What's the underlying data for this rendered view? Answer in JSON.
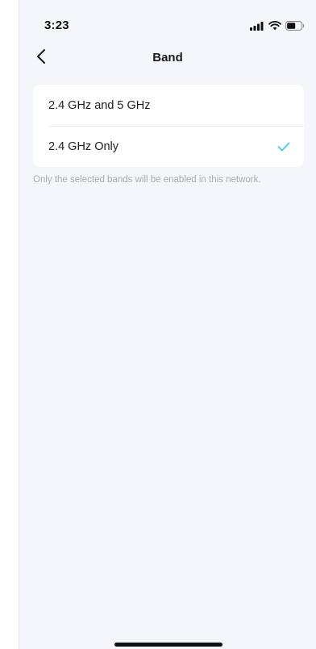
{
  "status_bar": {
    "time": "3:23",
    "icons": [
      "signal-icon",
      "wifi-icon",
      "battery-icon"
    ]
  },
  "header": {
    "back_icon": "chevron-left-icon",
    "title": "Band"
  },
  "band_options": [
    {
      "label": "2.4 GHz and 5 GHz",
      "selected": false
    },
    {
      "label": "2.4 GHz Only",
      "selected": true
    }
  ],
  "footnote": "Only the selected bands will be enabled in this network.",
  "colors": {
    "background": "#f5f6fa",
    "card": "#ffffff",
    "accent_check": "#4ac9e3",
    "footnote_text": "#a8abb3"
  }
}
